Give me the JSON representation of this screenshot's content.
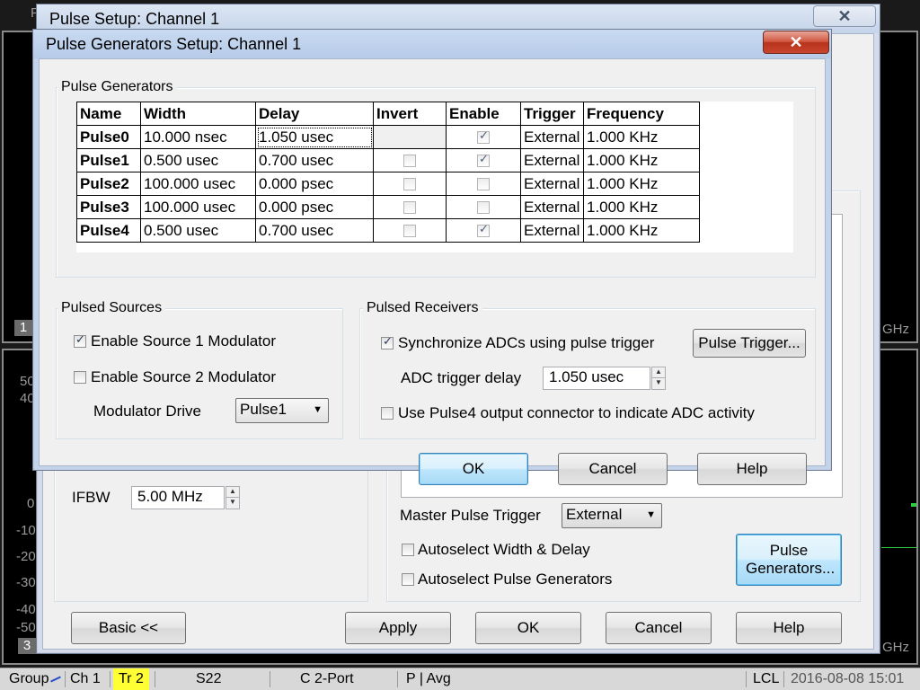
{
  "background": {
    "plot_labels": [
      "50",
      "40",
      "0",
      "-10",
      "-20",
      "-30",
      "-40",
      "-50"
    ],
    "trace_numbers": [
      "1",
      "3"
    ],
    "ghz_label": "GHz",
    "title_partial": "F"
  },
  "status_bar": {
    "group": "Group",
    "channel": "Ch 1",
    "trace": "Tr 2",
    "parameter": "S22",
    "port": "C  2-Port",
    "mode": "P | Avg",
    "lcl": "LCL",
    "datetime": "2016-08-08 15:01"
  },
  "pulse_setup": {
    "title": "Pulse Setup: Channel 1",
    "close_glyph": "✕",
    "ifbw_label": "IFBW",
    "ifbw_value": "5.00 MHz",
    "master_trigger_label": "Master Pulse Trigger",
    "master_trigger_value": "External",
    "autoselect_width_delay": "Autoselect Width & Delay",
    "autoselect_generators": "Autoselect Pulse Generators",
    "pulse_generators_button": "Pulse Generators...",
    "buttons": {
      "basic": "Basic <<",
      "apply": "Apply",
      "ok": "OK",
      "cancel": "Cancel",
      "help": "Help"
    }
  },
  "generators_dialog": {
    "title": "Pulse Generators Setup: Channel 1",
    "close_glyph": "✕",
    "group_generators": "Pulse Generators",
    "columns": [
      "Name",
      "Width",
      "Delay",
      "Invert",
      "Enable",
      "Trigger",
      "Frequency"
    ],
    "rows": [
      {
        "name": "Pulse0",
        "width": "10.000 nsec",
        "delay": "1.050 usec",
        "invert": null,
        "enable": true,
        "trigger": "External",
        "frequency": "1.000 KHz"
      },
      {
        "name": "Pulse1",
        "width": "0.500 usec",
        "delay": "0.700 usec",
        "invert": false,
        "enable": true,
        "trigger": "External",
        "frequency": "1.000 KHz"
      },
      {
        "name": "Pulse2",
        "width": "100.000 usec",
        "delay": "0.000 psec",
        "invert": false,
        "enable": false,
        "trigger": "External",
        "frequency": "1.000 KHz"
      },
      {
        "name": "Pulse3",
        "width": "100.000 usec",
        "delay": "0.000 psec",
        "invert": false,
        "enable": false,
        "trigger": "External",
        "frequency": "1.000 KHz"
      },
      {
        "name": "Pulse4",
        "width": "0.500 usec",
        "delay": "0.700 usec",
        "invert": false,
        "enable": true,
        "trigger": "External",
        "frequency": "1.000 KHz"
      }
    ],
    "pulsed_sources": {
      "title": "Pulsed Sources",
      "enable_source1": "Enable Source 1 Modulator",
      "enable_source1_checked": true,
      "enable_source2": "Enable Source 2 Modulator",
      "enable_source2_checked": false,
      "modulator_drive_label": "Modulator Drive",
      "modulator_drive_value": "Pulse1"
    },
    "pulsed_receivers": {
      "title": "Pulsed Receivers",
      "sync_adcs": "Synchronize ADCs using pulse trigger",
      "sync_adcs_checked": true,
      "pulse_trigger_button": "Pulse Trigger...",
      "adc_delay_label": "ADC trigger delay",
      "adc_delay_value": "1.050 usec",
      "use_pulse4": "Use Pulse4 output connector to indicate ADC activity",
      "use_pulse4_checked": false
    },
    "buttons": {
      "ok": "OK",
      "cancel": "Cancel",
      "help": "Help"
    }
  }
}
